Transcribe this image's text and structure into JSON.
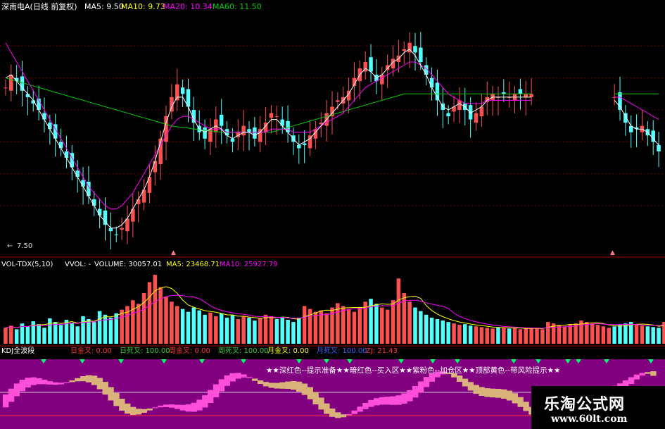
{
  "title": {
    "stock": "深南电A(日线 前复权)",
    "ma5": "MA5: 9.50",
    "ma10": "MA10: 9.73",
    "ma20": "MA20: 10.34",
    "ma60": "MA60: 11.50",
    "low_label": "7.50"
  },
  "volume_header": {
    "name": "VOL-TDX(5,10)",
    "vvol": "VVOL: -",
    "volume": "VOLUME: 30057.01",
    "ma5": "MA5: 23468.71",
    "ma10": "MA10: 25927.79"
  },
  "indicator_header": {
    "name": "KDJ全波段",
    "items": [
      {
        "label": "日金叉:",
        "value": "0.00",
        "color": "#ff3333"
      },
      {
        "label": "日死叉:",
        "value": "100.00",
        "color": "#33cc33"
      },
      {
        "label": "周金叉:",
        "value": "0.00",
        "color": "#ff3333"
      },
      {
        "label": "周死叉:",
        "value": "100.00",
        "color": "#33cc33"
      },
      {
        "label": "月金叉:",
        "value": "0.00",
        "color": "#ffff00"
      },
      {
        "label": "月死叉:",
        "value": "100.00",
        "color": "#3366ff"
      },
      {
        "label": "ZJ:",
        "value": "21.43",
        "color": "#ff3333"
      }
    ]
  },
  "legend_text": "★★深红色--提示准备★★暗红色--买入区★★紫粉色--加仓区★★顶部黄色--带风险提示★★",
  "watermark": {
    "name": "乐淘公式网",
    "url": "www.60lt.com"
  },
  "colors": {
    "up": "#ff5050",
    "down": "#54ffff",
    "ma5": "#ffffff",
    "ma10": "#ffff00",
    "ma20": "#ff00ff",
    "ma60": "#00cc00",
    "panel_bg": "#800080",
    "grid": "#800000"
  },
  "chart_data": [
    {
      "type": "candlestick",
      "name": "price",
      "ylim": [
        7.0,
        14.5
      ],
      "low_marker": 7.5,
      "close": [
        12.2,
        12.6,
        12.4,
        12.1,
        11.9,
        11.7,
        11.5,
        11.2,
        10.9,
        10.6,
        10.3,
        10.0,
        9.7,
        9.4,
        9.1,
        8.8,
        8.5,
        8.2,
        7.9,
        7.7,
        7.6,
        7.8,
        8.1,
        8.4,
        8.7,
        9.0,
        9.4,
        9.9,
        10.6,
        11.3,
        11.9,
        12.3,
        12.0,
        11.6,
        11.1,
        10.8,
        10.6,
        10.9,
        11.2,
        11.0,
        10.7,
        10.5,
        10.8,
        11.0,
        10.8,
        10.6,
        10.9,
        11.1,
        11.4,
        11.3,
        11.0,
        10.8,
        10.5,
        10.3,
        10.4,
        10.7,
        10.9,
        11.1,
        11.4,
        11.6,
        11.8,
        11.9,
        12.1,
        12.5,
        12.8,
        13.0,
        12.7,
        12.4,
        12.6,
        12.9,
        13.1,
        13.2,
        13.4,
        13.6,
        13.3,
        13.0,
        12.6,
        12.2,
        11.8,
        11.5,
        11.3,
        11.6,
        11.8,
        11.5,
        11.2,
        11.4,
        11.6,
        11.9,
        12.0,
        11.9,
        12.0,
        11.9,
        12.0,
        12.0,
        12.0,
        12.0,
        12.0,
        12.0,
        12.0,
        12.0,
        12.0,
        12.0,
        12.0,
        12.0,
        12.0,
        12.0,
        12.0,
        12.0,
        12.0,
        12.0,
        11.9,
        11.5,
        11.1,
        10.8,
        10.9,
        11.0,
        10.7,
        10.5,
        10.2
      ],
      "ma5": [
        12.5,
        12.6,
        12.4,
        12.2,
        12.0,
        11.8,
        11.5,
        11.2,
        10.9,
        10.6,
        10.3,
        10.0,
        9.7,
        9.4,
        9.1,
        8.8,
        8.5,
        8.2,
        8.0,
        7.8,
        7.8,
        7.9,
        8.1,
        8.4,
        8.7,
        9.0,
        9.4,
        9.9,
        10.5,
        11.1,
        11.6,
        11.9,
        11.9,
        11.6,
        11.2,
        10.9,
        10.8,
        10.9,
        11.0,
        10.9,
        10.7,
        10.6,
        10.7,
        10.8,
        10.8,
        10.7,
        10.8,
        11.0,
        11.2,
        11.2,
        11.0,
        10.8,
        10.6,
        10.4,
        10.5,
        10.6,
        10.8,
        11.0,
        11.2,
        11.4,
        11.6,
        11.8,
        12.0,
        12.3,
        12.6,
        12.8,
        12.7,
        12.5,
        12.6,
        12.8,
        13.0,
        13.1,
        13.3,
        13.4,
        13.2,
        12.9,
        12.6,
        12.2,
        11.9,
        11.6,
        11.5,
        11.6,
        11.7,
        11.6,
        11.4,
        11.5,
        11.6,
        11.8,
        11.9,
        11.9,
        11.9,
        11.9,
        11.9,
        11.9,
        11.9,
        11.9,
        11.9,
        11.9,
        11.9,
        11.9,
        11.9,
        11.9,
        11.9,
        11.9,
        11.9,
        11.9,
        11.9,
        11.9,
        11.9,
        11.9,
        11.8,
        11.6,
        11.3,
        11.0,
        10.9,
        10.9,
        10.8,
        10.6,
        10.4
      ],
      "ma20": [
        13.6,
        13.3,
        13.0,
        12.7,
        12.4,
        12.1,
        11.8,
        11.5,
        11.2,
        10.9,
        10.6,
        10.3,
        10.0,
        9.7,
        9.4,
        9.1,
        8.9,
        8.7,
        8.5,
        8.4,
        8.4,
        8.5,
        8.7,
        8.9,
        9.2,
        9.5,
        9.8,
        10.1,
        10.4,
        10.7,
        11.0,
        11.2,
        11.3,
        11.3,
        11.2,
        11.1,
        11.0,
        10.9,
        10.9,
        10.9,
        10.8,
        10.8,
        10.8,
        10.8,
        10.8,
        10.8,
        10.8,
        10.8,
        10.9,
        10.9,
        10.9,
        10.9,
        10.8,
        10.8,
        10.8,
        10.8,
        10.9,
        11.0,
        11.1,
        11.2,
        11.3,
        11.4,
        11.6,
        11.8,
        12.0,
        12.2,
        12.3,
        12.4,
        12.5,
        12.6,
        12.7,
        12.8,
        12.9,
        13.0,
        13.0,
        12.9,
        12.8,
        12.6,
        12.4,
        12.2,
        12.0,
        11.9,
        11.8,
        11.7,
        11.7,
        11.7,
        11.7,
        11.8,
        11.8,
        11.8,
        11.8,
        11.8,
        11.8,
        11.8,
        11.8,
        11.8,
        11.8,
        11.8,
        11.8,
        11.8,
        11.8,
        11.8,
        11.8,
        11.8,
        11.8,
        11.8,
        11.8,
        11.8,
        11.8,
        11.8,
        11.9,
        11.9,
        11.8,
        11.7,
        11.6,
        11.5,
        11.4,
        11.3,
        11.2
      ],
      "ma60": [
        12.5,
        12.45,
        12.4,
        12.35,
        12.3,
        12.25,
        12.2,
        12.15,
        12.1,
        12.05,
        12.0,
        11.95,
        11.9,
        11.85,
        11.8,
        11.75,
        11.7,
        11.65,
        11.6,
        11.55,
        11.5,
        11.45,
        11.4,
        11.35,
        11.3,
        11.25,
        11.2,
        11.15,
        11.1,
        11.05,
        11.0,
        10.97,
        10.95,
        10.93,
        10.9,
        10.88,
        10.86,
        10.84,
        10.82,
        10.8,
        10.8,
        10.8,
        10.8,
        10.8,
        10.8,
        10.8,
        10.8,
        10.8,
        10.8,
        10.85,
        10.9,
        10.95,
        11.0,
        11.05,
        11.1,
        11.15,
        11.2,
        11.25,
        11.3,
        11.35,
        11.4,
        11.45,
        11.5,
        11.55,
        11.6,
        11.65,
        11.7,
        11.75,
        11.8,
        11.85,
        11.9,
        11.95,
        12.0,
        12.0,
        12.0,
        12.0,
        12.0,
        12.0,
        12.0,
        12.0,
        12.0,
        12.0,
        12.0,
        12.0,
        12.0,
        12.0,
        12.0,
        12.0,
        12.0,
        12.0,
        12.0,
        12.0,
        12.0,
        12.0,
        12.0,
        12.0,
        12.0,
        12.0,
        12.0,
        12.0,
        12.0,
        12.0,
        12.0,
        12.0,
        12.0,
        12.0,
        12.0,
        12.0,
        12.0,
        12.0,
        12.0,
        12.0,
        12.0,
        12.0,
        12.0,
        12.0,
        12.0,
        12.0,
        12.0
      ]
    },
    {
      "type": "bar",
      "name": "volume",
      "ylim": [
        0,
        100000
      ],
      "values": [
        22000,
        25000,
        20000,
        28000,
        24000,
        31000,
        27000,
        22000,
        35000,
        30000,
        26000,
        33000,
        29000,
        24000,
        38000,
        34000,
        30000,
        45000,
        40000,
        36000,
        42000,
        47000,
        52000,
        60000,
        55000,
        70000,
        85000,
        95000,
        78000,
        65000,
        58000,
        52000,
        48000,
        44000,
        50000,
        46000,
        40000,
        43000,
        38000,
        42000,
        36000,
        40000,
        34000,
        38000,
        36000,
        32000,
        35000,
        40000,
        38000,
        34000,
        37000,
        33000,
        30000,
        36000,
        52000,
        48000,
        44000,
        46000,
        42000,
        50000,
        56000,
        52000,
        48000,
        44000,
        50000,
        58000,
        62000,
        55000,
        50000,
        47000,
        60000,
        90000,
        70000,
        58000,
        50000,
        45000,
        40000,
        36000,
        34000,
        32000,
        30000,
        28000,
        26000,
        27000,
        25000,
        24000,
        23000,
        22000,
        21000,
        23000,
        22000,
        21000,
        22000,
        20000,
        21000,
        22000,
        21000,
        20000,
        30000,
        28000,
        26000,
        24000,
        26000,
        28000,
        32000,
        30000,
        28000,
        26000,
        24000,
        22000,
        24000,
        26000,
        28000,
        30000,
        27000,
        25000,
        24000,
        23000,
        22000,
        30057
      ]
    }
  ]
}
